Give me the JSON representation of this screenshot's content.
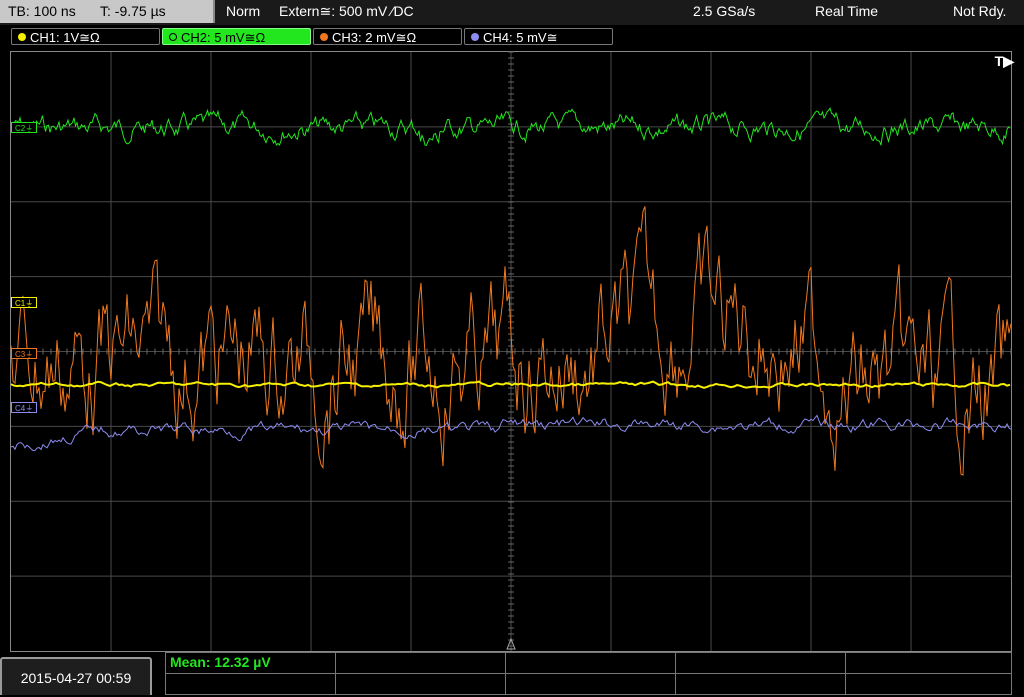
{
  "header": {
    "timebase": "TB: 100 ns",
    "trigger_time": "T: -9.75 µs",
    "mode": "Norm",
    "trigger_source": "Extern≅: 500 mV ⁄DC",
    "sample_rate": "2.5 GSa/s",
    "acquisition": "Real Time",
    "status": "Not Rdy."
  },
  "channels": [
    {
      "id": "ch1",
      "label": "CH1: 1V≅Ω",
      "color": "#f6f000",
      "active": false,
      "marker": "C1⏚"
    },
    {
      "id": "ch2",
      "label": "CH2: 5 mV≅Ω",
      "color": "#22e61e",
      "active": true,
      "marker": "C2⏚"
    },
    {
      "id": "ch3",
      "label": "CH3: 2 mV≅Ω",
      "color": "#f07820",
      "active": false,
      "marker": "C3⏚"
    },
    {
      "id": "ch4",
      "label": "CH4: 5 mV≅",
      "color": "#8c8cf0",
      "active": false,
      "marker": "C4⏚"
    }
  ],
  "trigger_marker": "T▶",
  "footer": {
    "datetime": "2015-04-27 00:59",
    "measurement": "Mean: 12.32 µV"
  },
  "colors": {
    "grid": "#4a4a4a",
    "border": "#888888",
    "background": "#000000"
  }
}
